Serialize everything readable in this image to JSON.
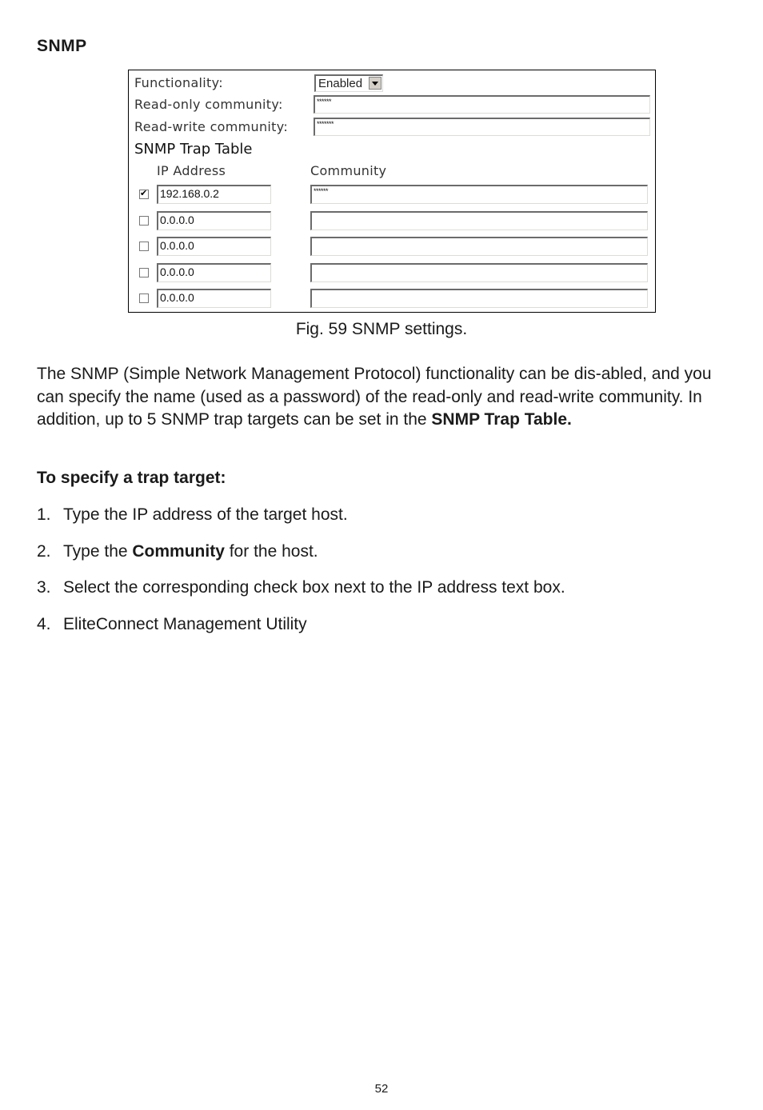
{
  "section_title": "SNMP",
  "figure": {
    "functionality_label": "Functionality:",
    "functionality_value": "Enabled",
    "read_only_label": "Read-only community:",
    "read_only_value": "******",
    "read_write_label": "Read-write community:",
    "read_write_value": "*******",
    "trap_table_title": "SNMP Trap Table",
    "col_ip": "IP Address",
    "col_community": "Community",
    "rows": [
      {
        "checked": true,
        "ip": "192.168.0.2",
        "community": "******"
      },
      {
        "checked": false,
        "ip": "0.0.0.0",
        "community": ""
      },
      {
        "checked": false,
        "ip": "0.0.0.0",
        "community": ""
      },
      {
        "checked": false,
        "ip": "0.0.0.0",
        "community": ""
      },
      {
        "checked": false,
        "ip": "0.0.0.0",
        "community": ""
      }
    ]
  },
  "caption": "Fig. 59 SNMP settings.",
  "paragraph": {
    "text": "The SNMP (Simple Network Management Protocol) functionality can be dis-abled, and you can specify the name (used as a password) of the read-only and read-write community. In addition, up to 5 SNMP trap targets can be set in the ",
    "bold_tail": "SNMP Trap Table."
  },
  "procedure_title": "To specify a trap target:",
  "steps": [
    {
      "num": "1.",
      "pre": "Type the IP address of the target host.",
      "bold": "",
      "post": ""
    },
    {
      "num": "2.",
      "pre": "Type the ",
      "bold": "Community",
      "post": " for the host."
    },
    {
      "num": "3.",
      "pre": "Select the corresponding check box next to the IP address text box.",
      "bold": "",
      "post": ""
    },
    {
      "num": "4.",
      "pre": "EliteConnect Management Utility",
      "bold": "",
      "post": ""
    }
  ],
  "page_number": "52"
}
